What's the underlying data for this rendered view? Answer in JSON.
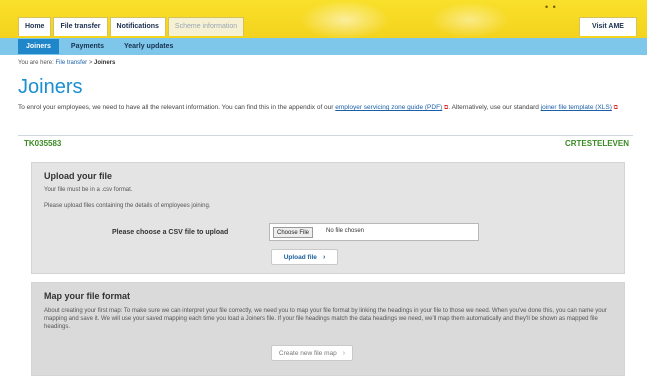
{
  "header": {
    "tabs": [
      {
        "label": "Home",
        "muted": false
      },
      {
        "label": "File transfer",
        "muted": false
      },
      {
        "label": "Notifications",
        "muted": false
      },
      {
        "label": "Scheme information",
        "muted": true
      }
    ],
    "visit_label": "Visit AME",
    "dots": "• •"
  },
  "subnav": {
    "items": [
      {
        "label": "Joiners",
        "active": true
      },
      {
        "label": "Payments",
        "active": false
      },
      {
        "label": "Yearly updates",
        "active": false
      }
    ]
  },
  "breadcrumb": {
    "prefix": "You are here: ",
    "link": "File transfer",
    "separator": " > ",
    "current": "Joiners"
  },
  "page": {
    "title": "Joiners",
    "intro_before": "To enrol your employees, we need to have all the relevant information. You can find this in the appendix of our ",
    "intro_link1": "employer servicing zone guide (PDF)",
    "intro_pdf_mark": "⧉",
    "intro_middle": ". Alternatively, use our standard ",
    "intro_link2": "joiner file template (XLS)",
    "intro_xls_mark": "⧉"
  },
  "account": {
    "reference": "TK035583",
    "organisation": "CRTESTELEVEN"
  },
  "upload": {
    "title": "Upload your file",
    "format_note": "Your file must be in a .csv format.",
    "instructions": "Please upload files containing the details of employees joining.",
    "choose_label": "Please choose a CSV file to upload",
    "file_button": "Choose File",
    "file_status": "No file chosen",
    "submit_label": "Upload file",
    "chevron": "›"
  },
  "map": {
    "title": "Map your file format",
    "description": "About creating your first map: To make sure we can interpret your file correctly, we need you to map your file format by linking the headings in your file to those we need. When you've done this, you can name your mapping and save it. We will use your saved mapping each time you load a Joiners file. If your file headings match the data headings we need, we'll map them automatically and they'll be shown as mapped file headings.",
    "button_label": "Create new file map",
    "chevron": "›"
  }
}
